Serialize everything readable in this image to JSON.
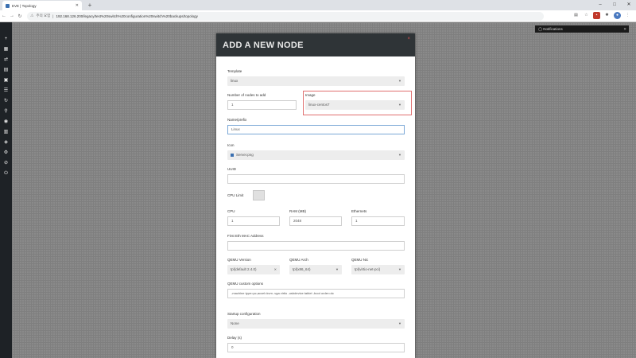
{
  "browser": {
    "tab_title": "EVE | Topology",
    "url_warning": "주의 요함",
    "url": "192.168.126.200/legacy/test%20switch%20configuration%20switch%20backups/topology",
    "window_controls": [
      "–",
      "□",
      "✕"
    ]
  },
  "notifications": {
    "label": "Notifications"
  },
  "modal": {
    "title": "ADD A NEW NODE",
    "close": "×",
    "template": {
      "label": "Template",
      "value": "linux"
    },
    "num_nodes": {
      "label": "Number of nodes to add",
      "value": "1"
    },
    "image": {
      "label": "Image",
      "value": "linux-centos7"
    },
    "name": {
      "label": "Name/prefix",
      "value": "Linux"
    },
    "icon": {
      "label": "Icon",
      "value": "Server.png"
    },
    "uuid": {
      "label": "UUID",
      "value": ""
    },
    "cpu_limit": {
      "label": "CPU Limit"
    },
    "cpu": {
      "label": "CPU",
      "value": "1"
    },
    "ram": {
      "label": "RAM (MB)",
      "value": "2048"
    },
    "ethernets": {
      "label": "Ethernets",
      "value": "1"
    },
    "mac": {
      "label": "First Eth MAC Address",
      "value": ""
    },
    "qemu_version": {
      "label": "QEMU Version",
      "value": "tpl(default 2.4.0)"
    },
    "qemu_arch": {
      "label": "QEMU Arch",
      "value": "tpl(x86_64)"
    },
    "qemu_nic": {
      "label": "QEMU Nic",
      "value": "tpl(virtio-net-pci)"
    },
    "qemu_options": {
      "label": "QEMU custom options",
      "value": "-machine type=pc,accel=kvm -vga virtio -usbdevice tablet -boot order=dc"
    },
    "startup": {
      "label": "Startup configuration",
      "value": "None"
    },
    "delay": {
      "label": "Delay (s)",
      "value": "0"
    }
  }
}
